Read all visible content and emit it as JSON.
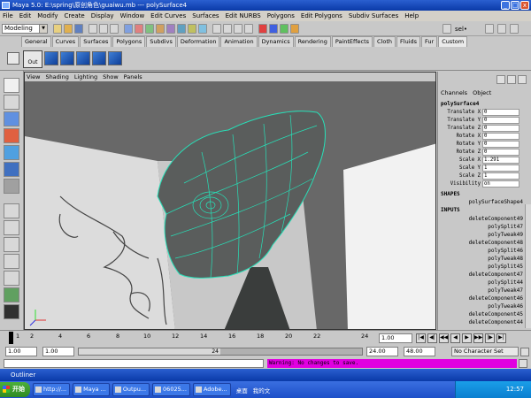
{
  "window": {
    "title": "Maya 5.0: E:\\spring\\原创角色\\guaiwu.mb  ---  polySurface4",
    "min": "_",
    "max": "□",
    "close": "x"
  },
  "menu": [
    "File",
    "Edit",
    "Modify",
    "Create",
    "Display",
    "Window",
    "Edit Curves",
    "Surfaces",
    "Edit NURBS",
    "Polygons",
    "Edit Polygons",
    "Subdiv Surfaces",
    "Help"
  ],
  "status": {
    "mode": "Modeling",
    "sel_label": "sel•"
  },
  "shelf_tabs": [
    "General",
    "Curves",
    "Surfaces",
    "Polygons",
    "Subdivs",
    "Deformation",
    "Animation",
    "Dynamics",
    "Rendering",
    "PaintEffects",
    "Cloth",
    "Fluids",
    "Fur",
    "Custom"
  ],
  "shelf_active": "Custom",
  "shelf": {
    "out_label": "Out"
  },
  "viewport_menu": [
    "View",
    "Shading",
    "Lighting",
    "Show",
    "Panels"
  ],
  "channelbox": {
    "tabs": [
      "Channels",
      "Object"
    ],
    "object": "polySurface4",
    "attrs": [
      {
        "label": "Translate X",
        "value": "0"
      },
      {
        "label": "Translate Y",
        "value": "0"
      },
      {
        "label": "Translate Z",
        "value": "0"
      },
      {
        "label": "Rotate X",
        "value": "0"
      },
      {
        "label": "Rotate Y",
        "value": "0"
      },
      {
        "label": "Rotate Z",
        "value": "0"
      },
      {
        "label": "Scale X",
        "value": "1.291"
      },
      {
        "label": "Scale Y",
        "value": "1"
      },
      {
        "label": "Scale Z",
        "value": "1"
      },
      {
        "label": "Visibility",
        "value": "on"
      }
    ],
    "shapes_header": "SHAPES",
    "shape": "polySurfaceShape4",
    "inputs_header": "INPUTS",
    "inputs": [
      "deleteComponent49",
      "polySplit47",
      "polyTweak49",
      "deleteComponent48",
      "polySplit46",
      "polyTweak48",
      "polySplit45",
      "deleteComponent47",
      "polySplit44",
      "polyTweak47",
      "deleteComponent46",
      "polyTweak46",
      "deleteComponent45",
      "deleteComponent44"
    ]
  },
  "timeline": {
    "ticks": [
      "1",
      "2",
      "4",
      "6",
      "8",
      "10",
      "12",
      "14",
      "16",
      "18",
      "20",
      "22",
      "24"
    ],
    "current": "1.00"
  },
  "range": {
    "start": "1.00",
    "start2": "1.00",
    "slider_mid": "24",
    "end": "24.00",
    "end2": "48.00",
    "charset": "No Character Set"
  },
  "command": {
    "warning": "Warning: No changes to save."
  },
  "outliner": {
    "title": "Outliner"
  },
  "taskbar": {
    "start": "开始",
    "tasks": [
      "http://...",
      "Maya ...",
      "Outpu...",
      "06025...",
      "Adobe..."
    ],
    "desktop": "桌面",
    "ime": "我的文",
    "clock": "12:57"
  }
}
